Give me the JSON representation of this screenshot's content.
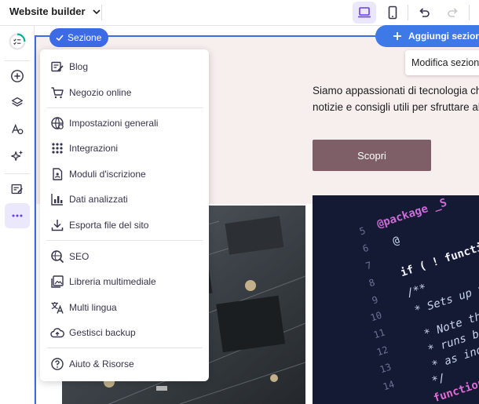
{
  "app": {
    "title": "Website builder"
  },
  "toolbar": {
    "desktop_icon": "laptop-icon",
    "mobile_icon": "phone-icon",
    "undo_icon": "undo-icon",
    "redo_icon": "redo-icon",
    "active_color": "#ece8fb"
  },
  "sidebar": {
    "items": [
      {
        "icon": "progress-checklist-icon"
      },
      {
        "icon": "add-icon"
      },
      {
        "icon": "layers-icon"
      },
      {
        "icon": "styles-icon"
      },
      {
        "icon": "ai-sparkle-icon"
      },
      {
        "icon": "blog-edit-icon"
      },
      {
        "icon": "more-icon"
      }
    ]
  },
  "selection": {
    "badge_label": "Sezione",
    "add_section_label": "Aggiungi sezione",
    "edit_section_label": "Modifica sezione",
    "accent_color": "#3d6be6"
  },
  "page": {
    "hero_line1": "Siamo appassionati di tecnologia che v",
    "hero_line2": "notizie e consigli utili per sfruttare al m",
    "cta_label": "Scopri",
    "cta_color": "#7e5f68",
    "code_lines": [
      "@package _S",
      "@",
      "if ( ! functi",
      "/**",
      " * Sets up t",
      " * Note tha",
      " * runs be",
      " * as indi",
      " */",
      "function"
    ],
    "line_numbers": [
      "5",
      "6",
      "7",
      "8",
      "9",
      "10",
      "11",
      "12",
      "13",
      "14"
    ]
  },
  "menu": {
    "items": [
      {
        "label": "Blog",
        "icon": "blog-icon"
      },
      {
        "label": "Negozio online",
        "icon": "cart-icon"
      },
      {
        "label": "Impostazioni generali",
        "icon": "globe-settings-icon"
      },
      {
        "label": "Integrazioni",
        "icon": "grid-dots-icon"
      },
      {
        "label": "Moduli d'iscrizione",
        "icon": "form-icon"
      },
      {
        "label": "Dati analizzati",
        "icon": "bar-chart-icon"
      },
      {
        "label": "Esporta file del sito",
        "icon": "download-icon"
      },
      {
        "label": "SEO",
        "icon": "seo-search-icon"
      },
      {
        "label": "Libreria multimediale",
        "icon": "image-library-icon"
      },
      {
        "label": "Multi lingua",
        "icon": "translate-icon"
      },
      {
        "label": "Gestisci backup",
        "icon": "cloud-backup-icon"
      },
      {
        "label": "Aiuto & Risorse",
        "icon": "help-icon"
      }
    ]
  }
}
